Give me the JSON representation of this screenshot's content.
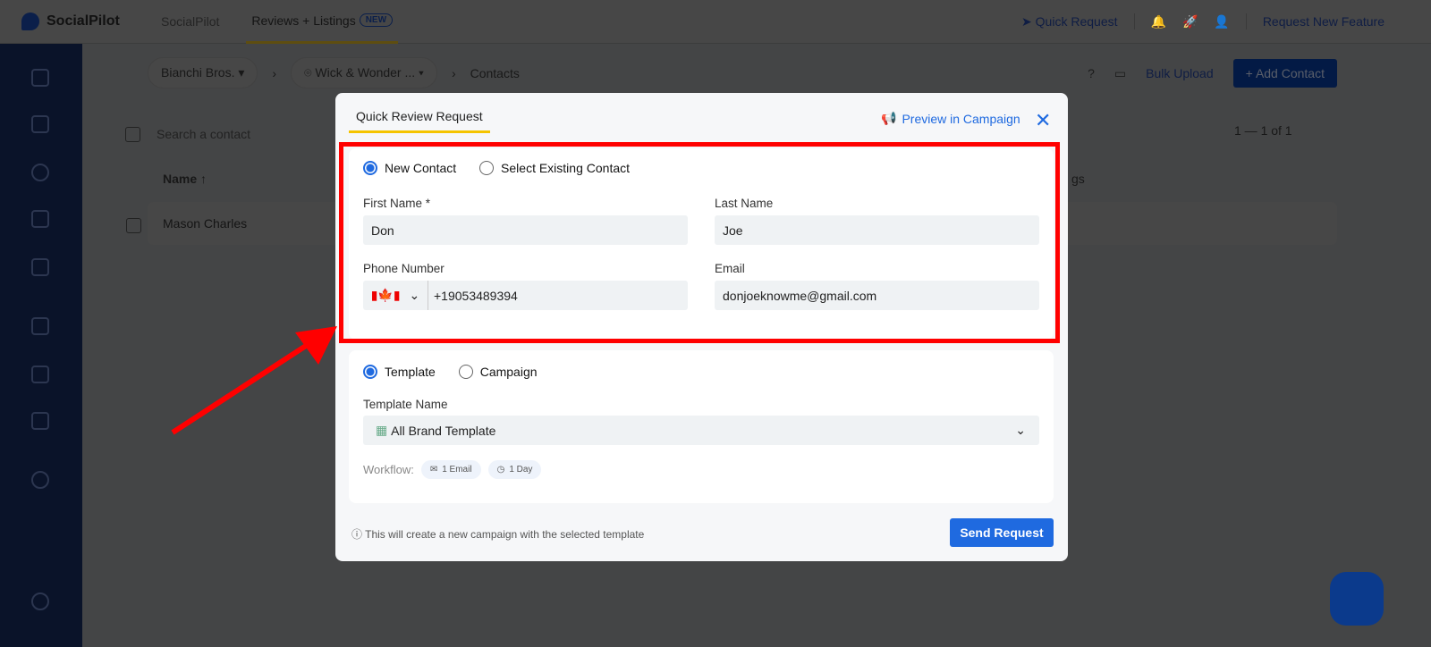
{
  "header": {
    "brand": "SocialPilot",
    "tabs": [
      "SocialPilot",
      "Reviews + Listings"
    ],
    "new_badge": "NEW",
    "quick_request": "Quick Request",
    "request_feature": "Request New Feature"
  },
  "breadcrumb": {
    "brand": "Bianchi Bros.",
    "location": "Wick & Wonder ...",
    "page": "Contacts"
  },
  "actions": {
    "bulk_upload": "Bulk Upload",
    "add_contact": "Add Contact"
  },
  "list": {
    "search_placeholder": "Search a contact",
    "col_name": "Name ↑",
    "col_tags": "gs",
    "pagination": "1 — 1 of 1",
    "rows": [
      {
        "name": "Mason Charles"
      }
    ]
  },
  "modal": {
    "tab": "Quick Review Request",
    "preview": "Preview in Campaign",
    "contact_options": [
      "New Contact",
      "Select Existing Contact"
    ],
    "first_name_label": "First Name *",
    "first_name": "Don",
    "last_name_label": "Last Name",
    "last_name": "Joe",
    "phone_label": "Phone Number",
    "phone": "+19053489394",
    "email_label": "Email",
    "email": "donjoeknowme@gmail.com",
    "source_options": [
      "Template",
      "Campaign"
    ],
    "template_label": "Template Name",
    "template": "All Brand Template",
    "workflow_label": "Workflow:",
    "workflow_email": "1 Email",
    "workflow_day": "1 Day",
    "info": "This will create a new campaign with the selected template",
    "send": "Send Request"
  },
  "colors": {
    "accent": "#1f6ae0",
    "highlight": "#ff0000"
  }
}
